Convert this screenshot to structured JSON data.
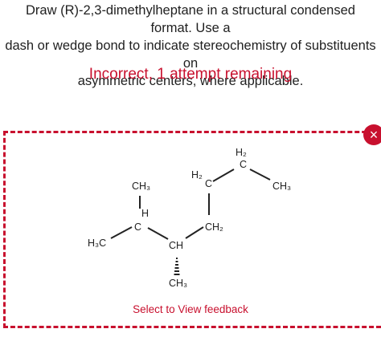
{
  "question": {
    "line1": "Draw (R)-2,3-dimethylheptane in a structural condensed format. Use a",
    "line2": "dash or wedge bond to indicate stereochemistry of substituents on",
    "line3": "asymmetric centers, where applicable."
  },
  "status_text": "Incorrect, 1 attempt remaining",
  "close_icon": "×",
  "structure": {
    "atoms": {
      "h3c_left": "H₃C",
      "c2_c": "C",
      "c2_h": "H",
      "c2_ch3": "CH₃",
      "c3_ch": "CH",
      "c3_ch3": "CH₃",
      "c4_ch2": "CH₂",
      "c5_c": "C",
      "c5_h2": "H₂",
      "c6_c": "C",
      "c6_h2": "H₂",
      "c7_ch3": "CH₃"
    }
  },
  "feedback_link": "Select to View feedback",
  "colors": {
    "accent": "#c8102e",
    "text": "#1f1f1f"
  }
}
